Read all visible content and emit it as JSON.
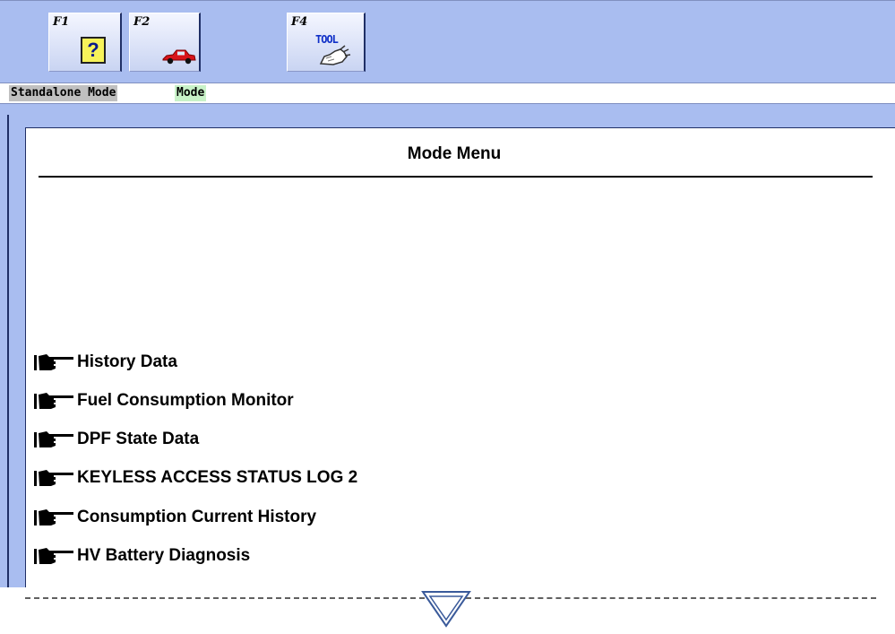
{
  "toolbar": {
    "keys": [
      {
        "label": "F1",
        "icon": "help-icon",
        "glyph": "?"
      },
      {
        "label": "F2",
        "icon": "car-icon"
      },
      {
        "label": "F4",
        "icon": "tool-icon",
        "text": "TOOL"
      }
    ]
  },
  "status": {
    "crumbs": [
      "Standalone Mode",
      "Mode"
    ]
  },
  "panel": {
    "title": "Mode Menu",
    "items": [
      {
        "label": " History Data"
      },
      {
        "label": "Fuel Consumption Monitor"
      },
      {
        "label": "DPF State Data"
      },
      {
        "label": "KEYLESS ACCESS STATUS LOG 2"
      },
      {
        "label": "Consumption Current History"
      },
      {
        "label": "HV Battery Diagnosis"
      }
    ]
  },
  "colors": {
    "toolbar_bg": "#a9bdf0",
    "crumb_grey": "#c0c0c0",
    "crumb_green": "#c8f2c8",
    "help_yellow": "#f7f35a",
    "car_red": "#d8141b"
  },
  "scroll": {
    "icon": "chevron-down-icon"
  }
}
